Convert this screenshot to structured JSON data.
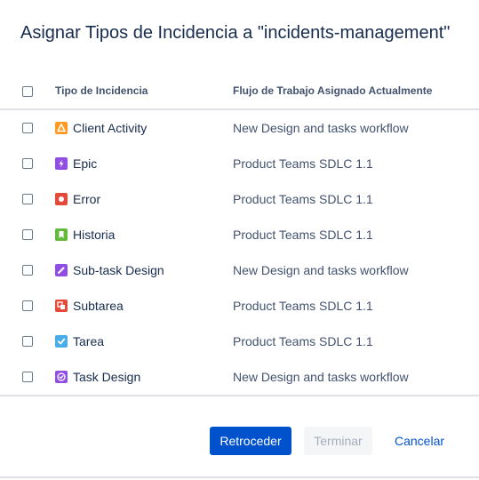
{
  "dialog": {
    "title": "Asignar Tipos de Incidencia a \"incidents-management\""
  },
  "table": {
    "headers": {
      "type": "Tipo de Incidencia",
      "workflow": "Flujo de Trabajo Asignado Actualmente"
    },
    "rows": [
      {
        "name": "Client Activity",
        "workflow": "New Design and tasks workflow",
        "icon": "warning-triangle-icon",
        "color": "#ff991f"
      },
      {
        "name": "Epic",
        "workflow": "Product Teams SDLC 1.1",
        "icon": "lightning-icon",
        "color": "#904ee2"
      },
      {
        "name": "Error",
        "workflow": "Product Teams SDLC 1.1",
        "icon": "bug-icon",
        "color": "#e5493a"
      },
      {
        "name": "Historia",
        "workflow": "Product Teams SDLC 1.1",
        "icon": "bookmark-icon",
        "color": "#63ba3c"
      },
      {
        "name": "Sub-task Design",
        "workflow": "New Design and tasks workflow",
        "icon": "pencil-icon",
        "color": "#904ee2"
      },
      {
        "name": "Subtarea",
        "workflow": "Product Teams SDLC 1.1",
        "icon": "subtask-icon",
        "color": "#e5493a"
      },
      {
        "name": "Tarea",
        "workflow": "Product Teams SDLC 1.1",
        "icon": "checkmark-icon",
        "color": "#4bade8"
      },
      {
        "name": "Task Design",
        "workflow": "New Design and tasks workflow",
        "icon": "check-circle-icon",
        "color": "#904ee2"
      }
    ]
  },
  "footer": {
    "back_label": "Retroceder",
    "finish_label": "Terminar",
    "cancel_label": "Cancelar"
  }
}
